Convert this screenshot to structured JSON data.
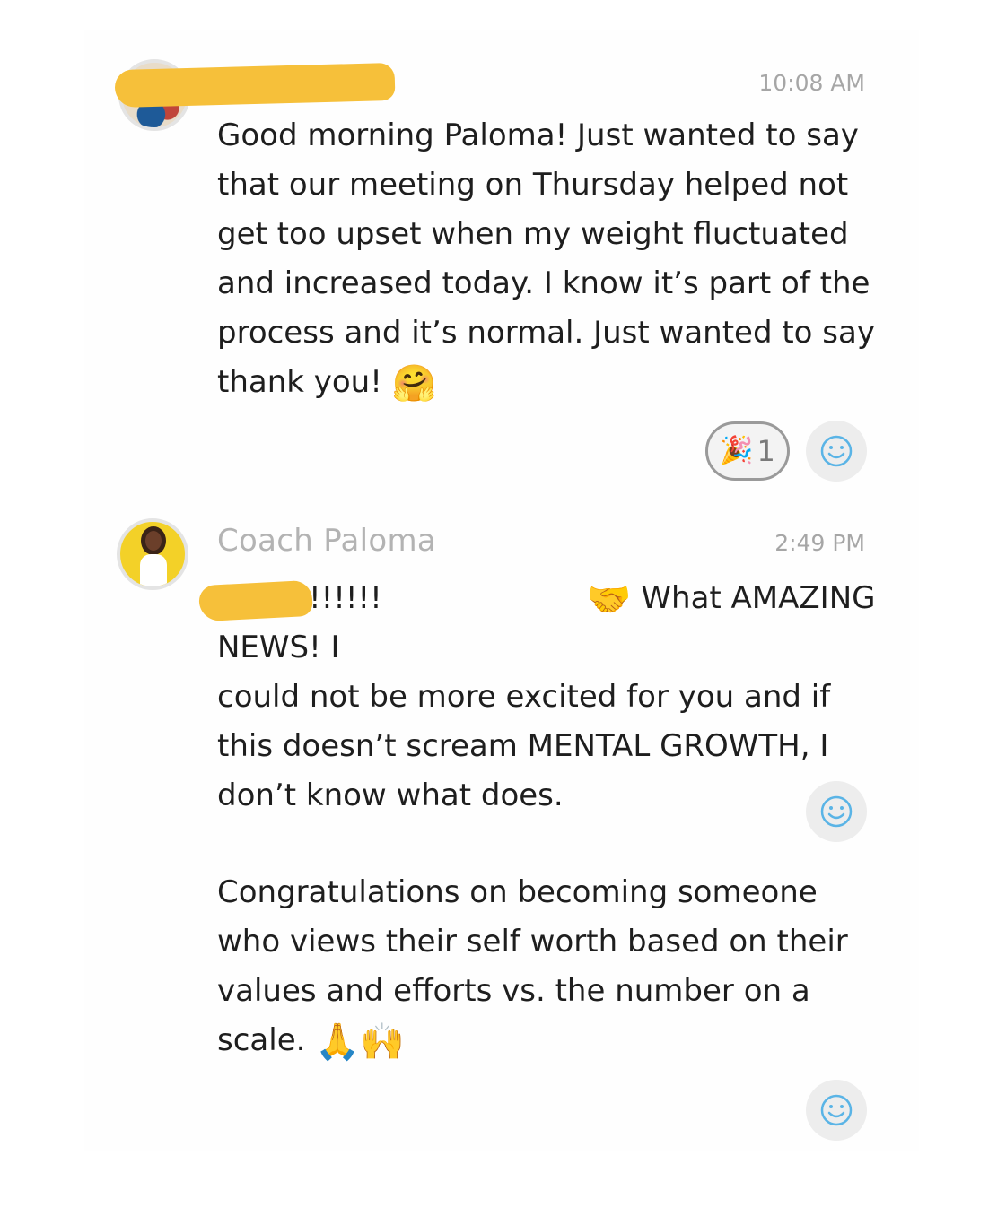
{
  "messages": [
    {
      "timestamp": "10:08 AM",
      "text": "Good morning Paloma! Just wanted to say\nthat our meeting on Thursday helped not\nget too upset when my weight fluctuated\nand increased today. I know it’s part of the\nprocess and it’s normal. Just wanted to say\nthank you! ",
      "emoji": "🤗",
      "reactions": [
        {
          "emoji": "🎉",
          "count": "1"
        }
      ]
    },
    {
      "sender": "Coach Paloma",
      "timestamp": "2:49 PM",
      "text_intro": "!!!!!!",
      "emoji_intro": "🤝",
      "text": " What AMAZING NEWS! I\ncould not be more excited for you and if\nthis doesn’t scream MENTAL GROWTH, I\ndon’t know what does."
    },
    {
      "text": "Congratulations on becoming someone\nwho views their self worth based on their\nvalues and efforts vs. the number on a\nscale. ",
      "emoji": "🙏🙌"
    }
  ],
  "icons": {
    "add_reaction": "smiley-icon",
    "accent": "#5ab4e6",
    "redaction": "#f6c03a"
  }
}
